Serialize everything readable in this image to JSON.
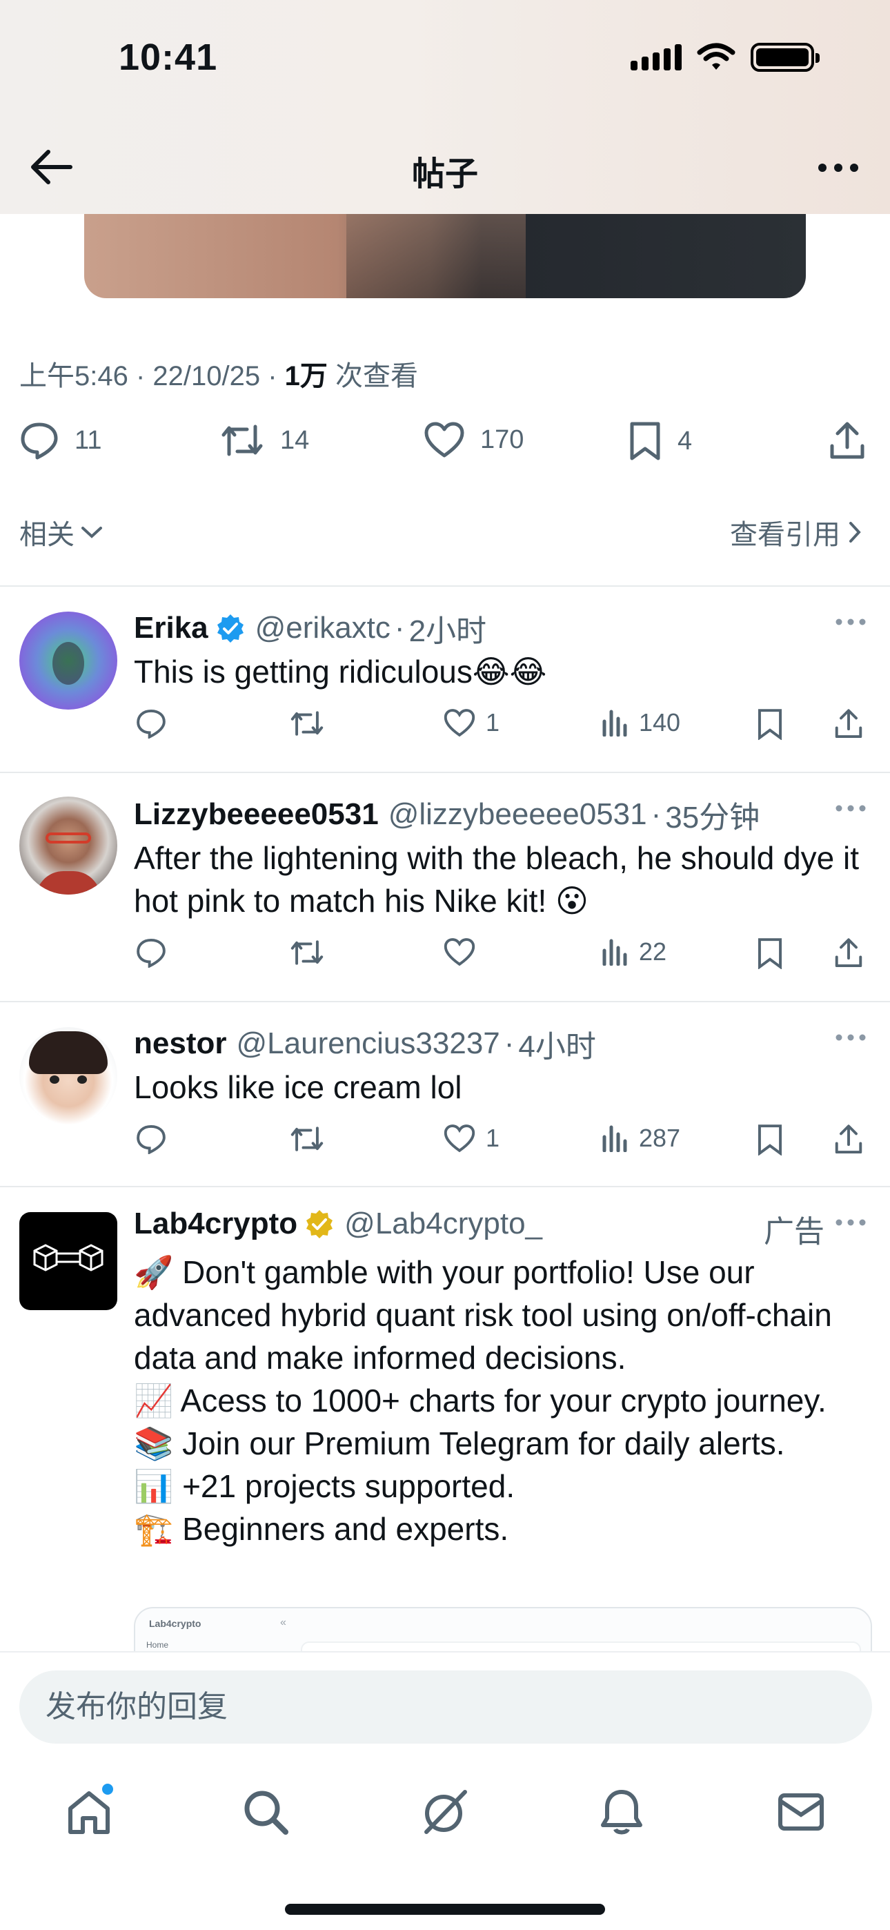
{
  "status_bar": {
    "time": "10:41"
  },
  "header": {
    "title": "帖子"
  },
  "post": {
    "time": "上午5:46",
    "date": "22/10/25",
    "views_count": "1万",
    "views_label": "次查看",
    "stats": {
      "replies": "11",
      "reposts": "14",
      "likes": "170",
      "bookmarks": "4"
    },
    "related_label": "相关",
    "quotes_label": "查看引用"
  },
  "replies": [
    {
      "name": "Erika",
      "handle": "@erikaxtc",
      "time": "2小时",
      "verified": "blue",
      "text": "This is getting ridiculous",
      "emoji": "😂😂",
      "likes": "1",
      "views": "140"
    },
    {
      "name": "Lizzybeeeee0531",
      "handle": "@lizzybeeeee0531",
      "time": "35分钟",
      "text": "After the lightening with the bleach, he should dye it hot pink to match his Nike kit!",
      "emoji": "😮",
      "likes": "",
      "views": "22"
    },
    {
      "name": "nestor",
      "handle": "@Laurencius33237",
      "time": "4小时",
      "text": "Looks like ice cream lol",
      "emoji": "",
      "likes": "1",
      "views": "287"
    }
  ],
  "ad": {
    "name": "Lab4crypto",
    "handle": "@Lab4crypto_",
    "verified": "gold",
    "label": "广告",
    "lines": [
      {
        "icon": "🚀",
        "text": "Don't gamble with your portfolio! Use our advanced hybrid quant risk tool using on/off-chain data and make informed decisions."
      },
      {
        "icon": "📈",
        "text": "Acess to 1000+ charts for your crypto journey."
      },
      {
        "icon": "📚",
        "text": "Join our Premium Telegram for daily alerts."
      },
      {
        "icon": "📊",
        "text": "+21 projects supported."
      },
      {
        "icon": "🏗️",
        "text": "Beginners and experts."
      }
    ],
    "card": {
      "brand": "Lab4crypto",
      "nav": "Home",
      "collapse": "«"
    }
  },
  "composer": {
    "placeholder": "发布你的回复"
  },
  "tabbar": [
    "home-icon",
    "search-icon",
    "grok-icon",
    "notifications-icon",
    "messages-icon"
  ],
  "colors": {
    "accent": "#1d9bf0",
    "verified_gold": "#e2b719",
    "secondary_text": "#536471"
  }
}
